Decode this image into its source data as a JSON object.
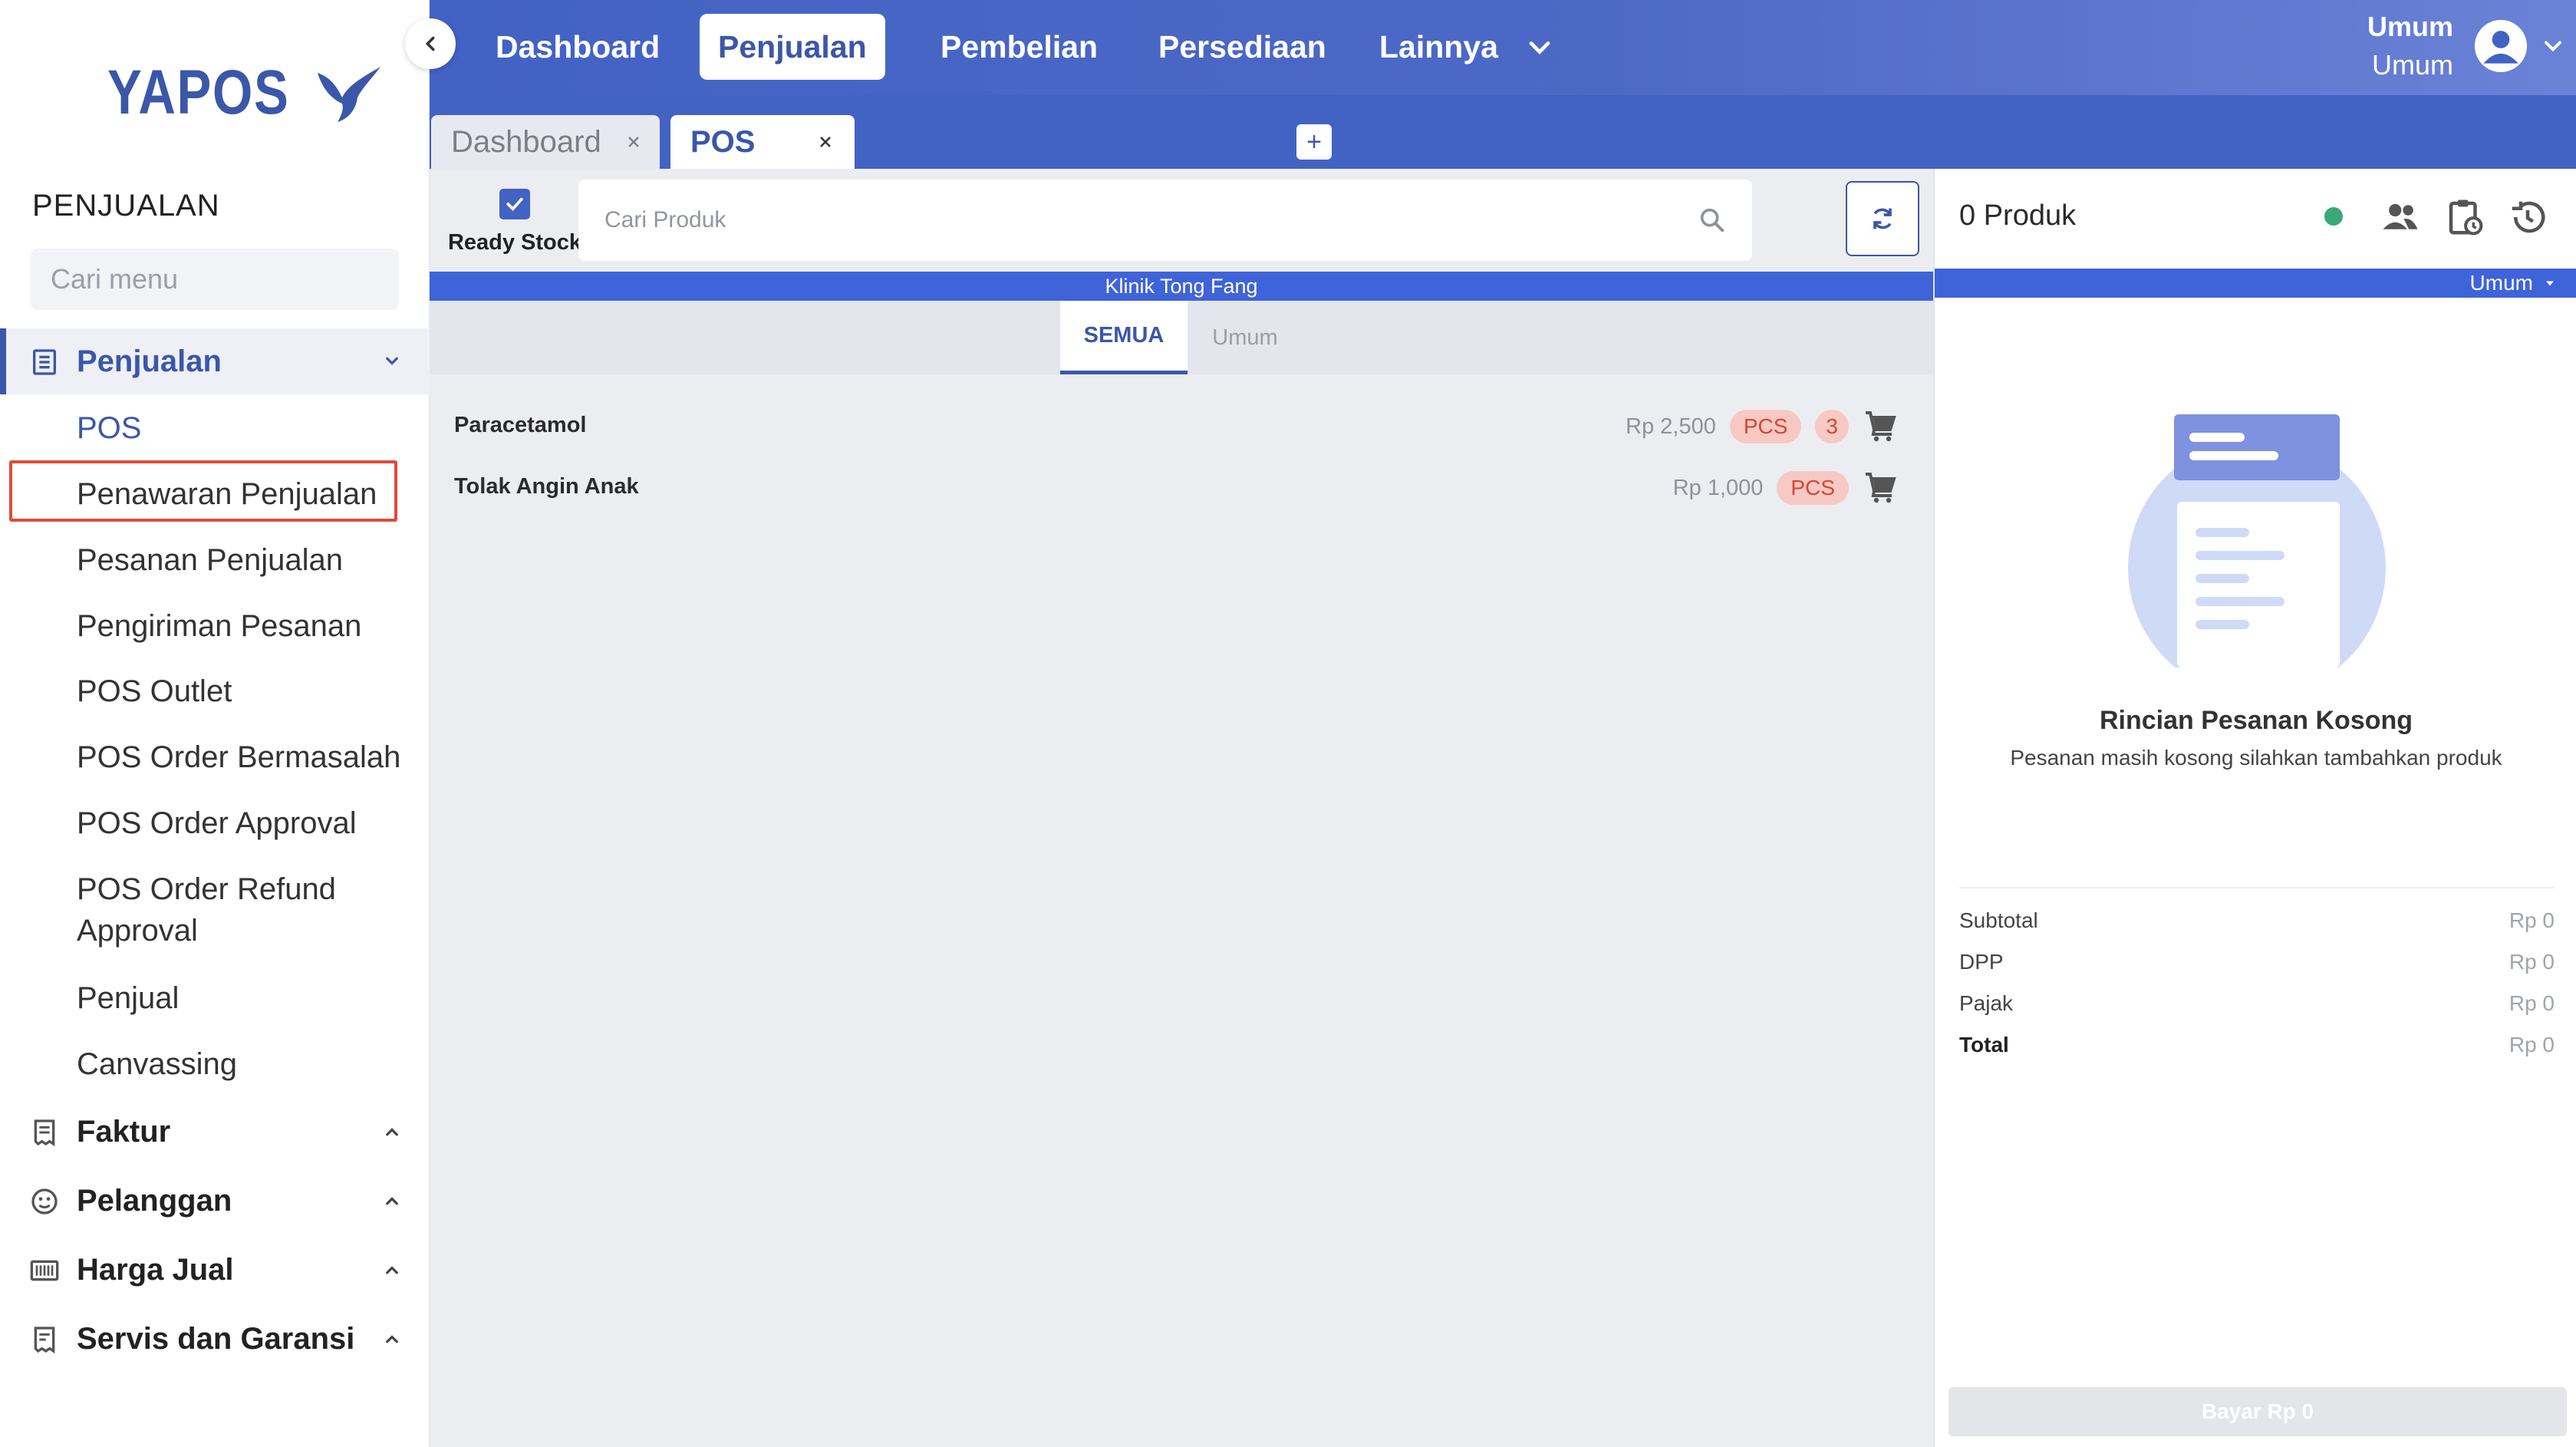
{
  "app": {
    "logo_text": "YAPOS"
  },
  "sidebar": {
    "section_title": "PENJUALAN",
    "search_placeholder": "Cari menu",
    "groups": [
      {
        "label": "Penjualan",
        "icon": "list-document-icon",
        "expanded": true
      },
      {
        "label": "Faktur",
        "icon": "receipt-icon",
        "expanded": false
      },
      {
        "label": "Pelanggan",
        "icon": "customer-icon",
        "expanded": false
      },
      {
        "label": "Harga Jual",
        "icon": "barcode-icon",
        "expanded": false
      },
      {
        "label": "Servis dan Garansi",
        "icon": "service-icon",
        "expanded": false
      }
    ],
    "sub_items": [
      "POS",
      "Penawaran Penjualan",
      "Pesanan Penjualan",
      "Pengiriman Pesanan",
      "POS Outlet",
      "POS Order Bermasalah",
      "POS Order Approval",
      "POS Order Refund",
      "Approval",
      "Penjual",
      "Canvassing"
    ]
  },
  "topnav": {
    "items": [
      "Dashboard",
      "Penjualan",
      "Pembelian",
      "Persediaan",
      "Lainnya"
    ],
    "active": "Penjualan",
    "user_name": "Umum",
    "user_role": "Umum"
  },
  "tabs": {
    "items": [
      {
        "label": "Dashboard",
        "active": false
      },
      {
        "label": "POS",
        "active": true
      }
    ],
    "add_label": "+"
  },
  "pos": {
    "ready_stock_label": "Ready Stock",
    "ready_stock_checked": true,
    "search_placeholder": "Cari Produk",
    "outlet_name": "Klinik Tong Fang",
    "categories": [
      "SEMUA",
      "Umum"
    ],
    "products": [
      {
        "name": "Paracetamol",
        "price": "Rp 2,500",
        "unit": "PCS",
        "qty": "3"
      },
      {
        "name": "Tolak Angin Anak",
        "price": "Rp 1,000",
        "unit": "PCS",
        "qty": ""
      }
    ]
  },
  "order": {
    "count_label": "0 Produk",
    "price_group": "Umum",
    "empty_title": "Rincian Pesanan Kosong",
    "empty_subtitle": "Pesanan masih kosong silahkan tambahkan produk",
    "summary": [
      {
        "label": "Subtotal",
        "value": "Rp 0"
      },
      {
        "label": "DPP",
        "value": "Rp 0"
      },
      {
        "label": "Pajak",
        "value": "Rp 0"
      },
      {
        "label": "Total",
        "value": "Rp 0"
      }
    ],
    "pay_label": "Bayar Rp 0"
  },
  "colors": {
    "brand": "#3b57a8",
    "nav": "#4262c4",
    "accent_bar": "#3f63d8",
    "highlight": "#e04b3a",
    "badge_bg": "#f7c9c4",
    "badge_text": "#d9452f"
  }
}
